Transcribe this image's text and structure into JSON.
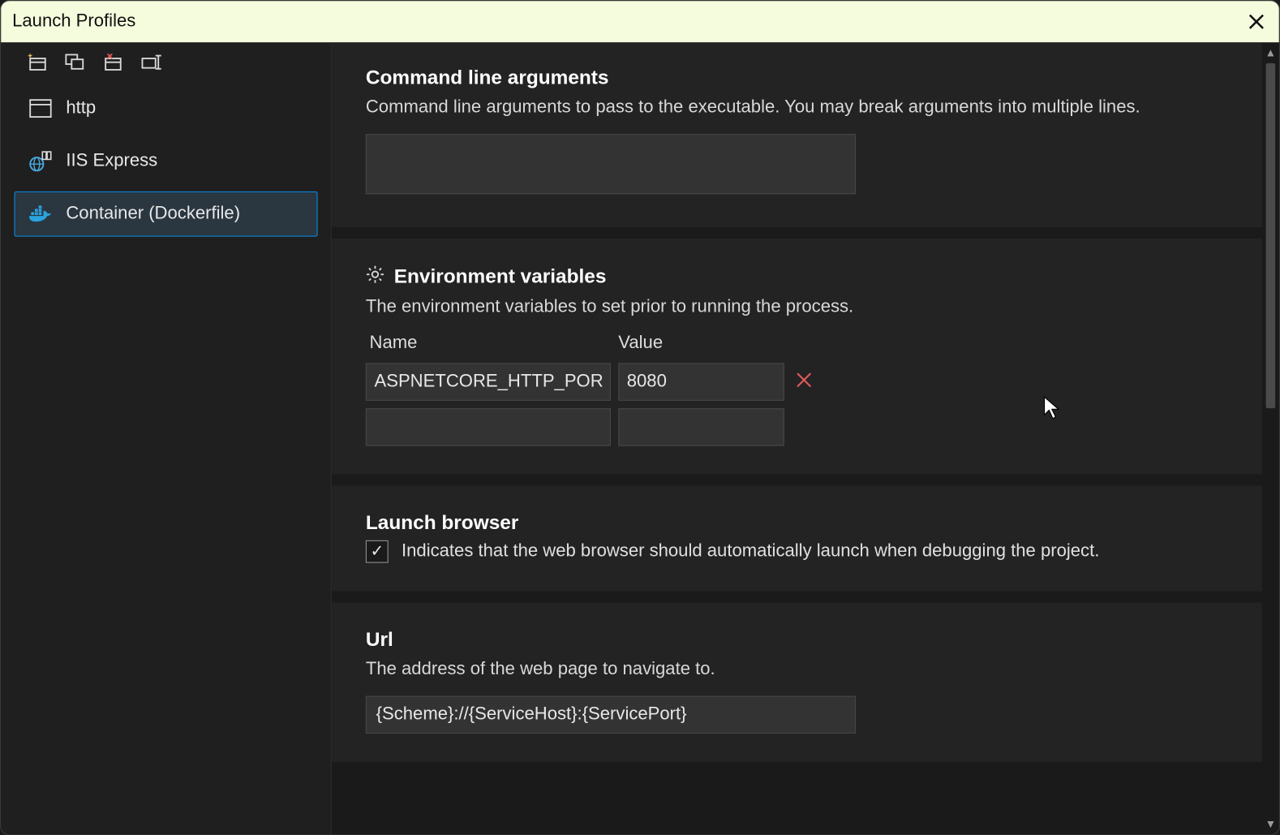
{
  "window": {
    "title": "Launch Profiles"
  },
  "toolbar": {
    "new_profile_tip": "New Profile",
    "duplicate_tip": "Duplicate Profile",
    "delete_tip": "Delete Profile",
    "rename_tip": "Rename Profile"
  },
  "sidebar": {
    "items": [
      {
        "label": "http",
        "icon": "browser-icon",
        "selected": false
      },
      {
        "label": "IIS Express",
        "icon": "globe-icon",
        "selected": false
      },
      {
        "label": "Container (Dockerfile)",
        "icon": "docker-icon",
        "selected": true
      }
    ]
  },
  "sections": {
    "cli": {
      "title": "Command line arguments",
      "desc": "Command line arguments to pass to the executable. You may break arguments into multiple lines.",
      "value": ""
    },
    "env": {
      "title": "Environment variables",
      "desc": "The environment variables to set prior to running the process.",
      "header_name": "Name",
      "header_value": "Value",
      "rows": [
        {
          "name": "ASPNETCORE_HTTP_PORTS",
          "value": "8080"
        },
        {
          "name": "",
          "value": ""
        }
      ]
    },
    "launch": {
      "title": "Launch browser",
      "desc": "Indicates that the web browser should automatically launch when debugging the project.",
      "checked": true
    },
    "url": {
      "title": "Url",
      "desc": "The address of the web page to navigate to.",
      "value": "{Scheme}://{ServiceHost}:{ServicePort}"
    }
  }
}
